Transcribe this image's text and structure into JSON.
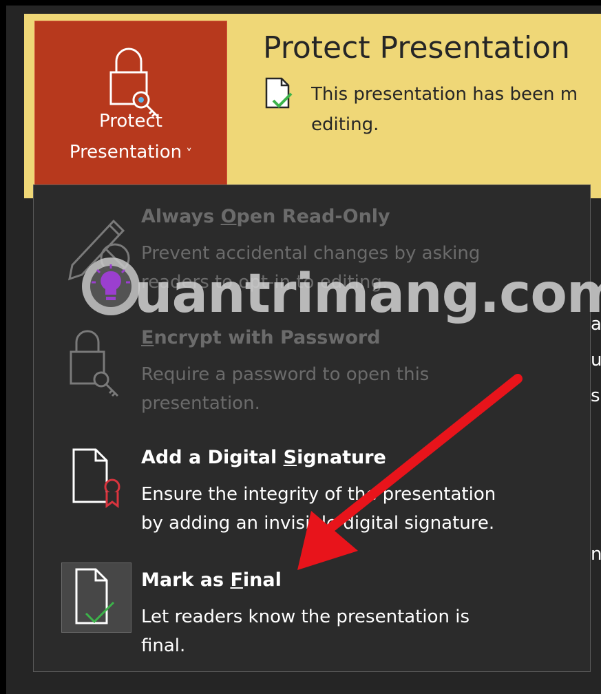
{
  "banner": {
    "button": {
      "line1": "Protect",
      "line2": "Presentation",
      "chevron": "˅",
      "icon": "lock-key-icon"
    },
    "title": "Protect Presentation",
    "desc_line1": "This presentation has been m",
    "desc_line2": "editing.",
    "icon": "final-document-icon"
  },
  "menu": {
    "items": [
      {
        "title_pre": "Always ",
        "title_ul": "O",
        "title_post": "pen Read-Only",
        "desc1": "Prevent accidental changes by asking",
        "desc2": "readers to opt-in to editing.",
        "enabled": false,
        "icon": "pencil-prohibit-icon"
      },
      {
        "title_pre": "",
        "title_ul": "E",
        "title_post": "ncrypt with Password",
        "desc1": "Require a password to open this",
        "desc2": "presentation.",
        "enabled": false,
        "icon": "lock-key-icon"
      },
      {
        "title_pre": "Add a Digital ",
        "title_ul": "S",
        "title_post": "ignature",
        "desc1": "Ensure the integrity of the presentation",
        "desc2": "by adding an invisible digital signature.",
        "enabled": true,
        "icon": "signature-document-icon"
      },
      {
        "title_pre": "Mark as ",
        "title_ul": "F",
        "title_post": "inal",
        "desc1": "Let readers know the presentation is",
        "desc2": "final.",
        "enabled": true,
        "icon": "final-document-icon"
      }
    ]
  },
  "side_fragments": [
    "a",
    "u",
    "s",
    "n"
  ],
  "watermark": {
    "text": "uantrimang.com",
    "icon": "lightbulb-logo-icon"
  },
  "colors": {
    "banner": "#efd777",
    "button": "#b7391d",
    "menu": "#2b2b2b",
    "arrow": "#e8141b",
    "check": "#3cb34a"
  }
}
